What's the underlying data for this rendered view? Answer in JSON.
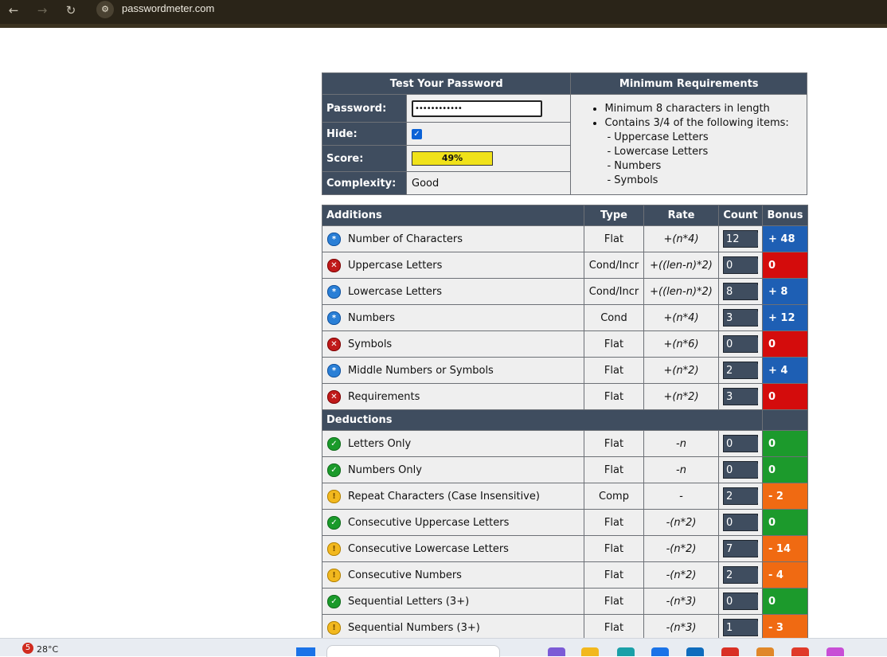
{
  "browser": {
    "url": "passwordmeter.com",
    "back_icon": "←",
    "forward_icon": "→",
    "reload_icon": "↻",
    "site_icon": "⚙"
  },
  "test_panel": {
    "header": "Test Your Password",
    "password_label": "Password:",
    "password_value": "••••••••••••",
    "hide_label": "Hide:",
    "hide_checked": true,
    "score_label": "Score:",
    "score_value": "49%",
    "score_fraction": 0.49,
    "complexity_label": "Complexity:",
    "complexity_value": "Good"
  },
  "requirements": {
    "header": "Minimum Requirements",
    "item1": "Minimum 8 characters in length",
    "item2": "Contains 3/4 of the following items:",
    "sub": [
      "- Uppercase Letters",
      "- Lowercase Letters",
      "- Numbers",
      "- Symbols"
    ]
  },
  "columns": {
    "additions": "Additions",
    "type": "Type",
    "rate": "Rate",
    "count": "Count",
    "bonus": "Bonus",
    "deductions": "Deductions"
  },
  "additions": [
    {
      "status": "exceed",
      "label": "Number of Characters",
      "type": "Flat",
      "rate": "+(n*4)",
      "count": "12",
      "bonus": "+ 48",
      "bonus_color": "blue"
    },
    {
      "status": "fail",
      "label": "Uppercase Letters",
      "type": "Cond/Incr",
      "rate": "+((len-n)*2)",
      "count": "0",
      "bonus": "0",
      "bonus_color": "red"
    },
    {
      "status": "exceed",
      "label": "Lowercase Letters",
      "type": "Cond/Incr",
      "rate": "+((len-n)*2)",
      "count": "8",
      "bonus": "+ 8",
      "bonus_color": "blue"
    },
    {
      "status": "exceed",
      "label": "Numbers",
      "type": "Cond",
      "rate": "+(n*4)",
      "count": "3",
      "bonus": "+ 12",
      "bonus_color": "blue"
    },
    {
      "status": "fail",
      "label": "Symbols",
      "type": "Flat",
      "rate": "+(n*6)",
      "count": "0",
      "bonus": "0",
      "bonus_color": "red"
    },
    {
      "status": "exceed",
      "label": "Middle Numbers or Symbols",
      "type": "Flat",
      "rate": "+(n*2)",
      "count": "2",
      "bonus": "+ 4",
      "bonus_color": "blue"
    },
    {
      "status": "fail",
      "label": "Requirements",
      "type": "Flat",
      "rate": "+(n*2)",
      "count": "3",
      "bonus": "0",
      "bonus_color": "red"
    }
  ],
  "deductions": [
    {
      "status": "pass",
      "label": "Letters Only",
      "type": "Flat",
      "rate": "-n",
      "count": "0",
      "bonus": "0",
      "bonus_color": "green"
    },
    {
      "status": "pass",
      "label": "Numbers Only",
      "type": "Flat",
      "rate": "-n",
      "count": "0",
      "bonus": "0",
      "bonus_color": "green"
    },
    {
      "status": "warn",
      "label": "Repeat Characters (Case Insensitive)",
      "type": "Comp",
      "rate": "-",
      "count": "2",
      "bonus": "- 2",
      "bonus_color": "orange"
    },
    {
      "status": "pass",
      "label": "Consecutive Uppercase Letters",
      "type": "Flat",
      "rate": "-(n*2)",
      "count": "0",
      "bonus": "0",
      "bonus_color": "green"
    },
    {
      "status": "warn",
      "label": "Consecutive Lowercase Letters",
      "type": "Flat",
      "rate": "-(n*2)",
      "count": "7",
      "bonus": "- 14",
      "bonus_color": "orange"
    },
    {
      "status": "warn",
      "label": "Consecutive Numbers",
      "type": "Flat",
      "rate": "-(n*2)",
      "count": "2",
      "bonus": "- 4",
      "bonus_color": "orange"
    },
    {
      "status": "pass",
      "label": "Sequential Letters (3+)",
      "type": "Flat",
      "rate": "-(n*3)",
      "count": "0",
      "bonus": "0",
      "bonus_color": "green"
    },
    {
      "status": "warn",
      "label": "Sequential Numbers (3+)",
      "type": "Flat",
      "rate": "-(n*3)",
      "count": "1",
      "bonus": "- 3",
      "bonus_color": "orange"
    }
  ],
  "status_glyphs": {
    "pass": "✓",
    "fail": "✕",
    "warn": "!",
    "exceed": "*"
  },
  "colors": {
    "header_bg": "#3f4d5f",
    "bonus_blue": "#1e5fb4",
    "bonus_red": "#d40c0c",
    "bonus_green": "#1c9a2c",
    "bonus_orange": "#f06a12",
    "score_bar": "#f0e21a"
  },
  "taskbar": {
    "weather_badge": "5",
    "weather_temp": "28°C"
  }
}
